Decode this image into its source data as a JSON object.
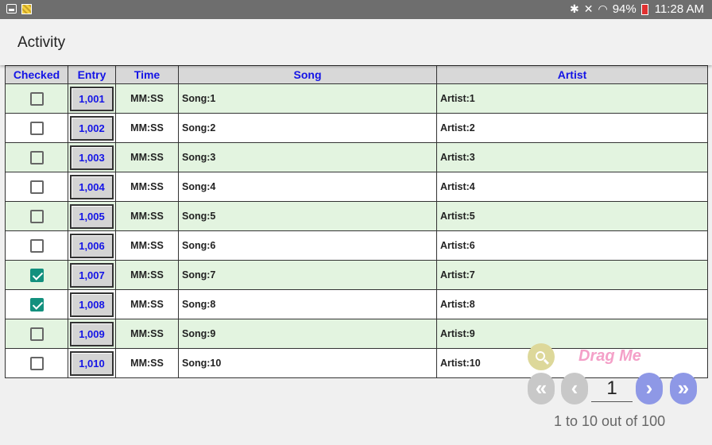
{
  "status_bar": {
    "battery": "94%",
    "time": "11:28 AM"
  },
  "app": {
    "title": "Activity"
  },
  "table": {
    "columns": [
      "Checked",
      "Entry",
      "Time",
      "Song",
      "Artist"
    ],
    "rows": [
      {
        "checked": false,
        "entry": "1,001",
        "time": "MM:SS",
        "song": "Song:1",
        "artist": "Artist:1"
      },
      {
        "checked": false,
        "entry": "1,002",
        "time": "MM:SS",
        "song": "Song:2",
        "artist": "Artist:2"
      },
      {
        "checked": false,
        "entry": "1,003",
        "time": "MM:SS",
        "song": "Song:3",
        "artist": "Artist:3"
      },
      {
        "checked": false,
        "entry": "1,004",
        "time": "MM:SS",
        "song": "Song:4",
        "artist": "Artist:4"
      },
      {
        "checked": false,
        "entry": "1,005",
        "time": "MM:SS",
        "song": "Song:5",
        "artist": "Artist:5"
      },
      {
        "checked": false,
        "entry": "1,006",
        "time": "MM:SS",
        "song": "Song:6",
        "artist": "Artist:6"
      },
      {
        "checked": true,
        "entry": "1,007",
        "time": "MM:SS",
        "song": "Song:7",
        "artist": "Artist:7"
      },
      {
        "checked": true,
        "entry": "1,008",
        "time": "MM:SS",
        "song": "Song:8",
        "artist": "Artist:8"
      },
      {
        "checked": false,
        "entry": "1,009",
        "time": "MM:SS",
        "song": "Song:9",
        "artist": "Artist:9"
      },
      {
        "checked": false,
        "entry": "1,010",
        "time": "MM:SS",
        "song": "Song:10",
        "artist": "Artist:10"
      }
    ]
  },
  "pager": {
    "drag_label": "Drag Me",
    "first_glyph": "«",
    "prev_glyph": "‹",
    "next_glyph": "›",
    "last_glyph": "»",
    "page_value": "1",
    "status": "1 to 10 out of 100"
  },
  "colors": {
    "header_text": "#1414e6",
    "odd_row": "#e3f4e0",
    "checkbox_on": "#13907e",
    "pager_active": "#8e98e6",
    "pager_disabled": "#c8c8c8",
    "drag_label": "#f4a0c8"
  },
  "icons": [
    "screenshot-icon",
    "image-icon",
    "bluetooth-icon",
    "mute-icon",
    "wifi-icon",
    "battery-icon",
    "search-icon"
  ]
}
